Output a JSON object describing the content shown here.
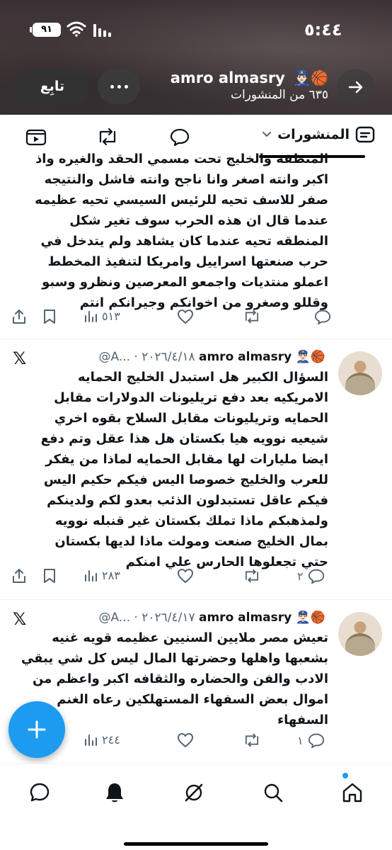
{
  "status_bar": {
    "time": "٥:٤٤",
    "battery": "٩١"
  },
  "header": {
    "profile_name": "amro almasry",
    "profile_emoji": "👮🏻‍♂️🏀",
    "post_count": "٦٣٥ من المنشورات",
    "follow_label": "تابِع"
  },
  "tabs": {
    "posts_label": "المنشورات"
  },
  "post_top": {
    "lines": [
      "المنطقه والخليج تحت مسمي الحقد والغيره واذ",
      "اكبر وانته اصغر وانا ناجح وانته فاشل والنتيجه",
      "صفر للاسف تحيه للرئيس السيسي تحيه عظيمه",
      "عندما قال ان هذه الحرب سوف تغير شكل",
      "المنطقه تحيه عندما كان يشاهد ولم يتدخل في",
      "حرب صنعتها اسراييل وامريكا لتنفيذ المخطط",
      "اعملو منتديات واجمعو المعرصين ونظرو وسبو",
      "وقللو وصغرو من اخوانكم وجيرانكم انتم"
    ],
    "views": "٥١٣"
  },
  "post_1": {
    "author": "amro almasry",
    "emoji": "👮🏻‍♂️🏀",
    "handle_date": "@A... · ٢٠٢٦/٤/١٨",
    "lines": [
      "السؤال الكبير هل استبدل الخليج الحمايه",
      "الامريكيه بعد دفع تريليونات الدولارات مقابل",
      "الحمايه وتريليونات مقابل السلاح بقوه اخري",
      "شيعيه نوويه هيا بكستان هل هذا عقل وتم دفع",
      "ايضا مليارات لها مقابل الحمايه لماذا من يفكر",
      "للعرب والخليج خصوصا اليس فيكم حكيم اليس",
      "فيكم عاقل تستبدلون الذئب بعدو لكم ولدينكم",
      "ولمذهبكم ماذا تملك بكستان غير قنبله نوويه",
      "بمال  الخليج  صنعت ومولت ماذا لديها بكستان",
      "حتي تجعلوها الحارس علي امنكم"
    ],
    "replies": "٢",
    "views": "٢٨٣"
  },
  "post_2": {
    "author": "amro almasry",
    "emoji": "👮🏻‍♂️🏀",
    "handle_date": "@A... · ٢٠٢٦/٤/١٧",
    "lines": [
      "تعيش مصر ملايين السنيين عظيمه قويه غنيه",
      "بشعبها واهلها وحضرتها المال ليس كل شي يبقي",
      "الادب والفن والحضاره والثقافه اكبر واعظم من",
      "اموال بعض السفهاء المستهلكين رعاه الغنم",
      "السفهاء"
    ],
    "replies": "١",
    "views": "٢٤٤"
  },
  "icons": {
    "accent": "#1d9bf0"
  }
}
